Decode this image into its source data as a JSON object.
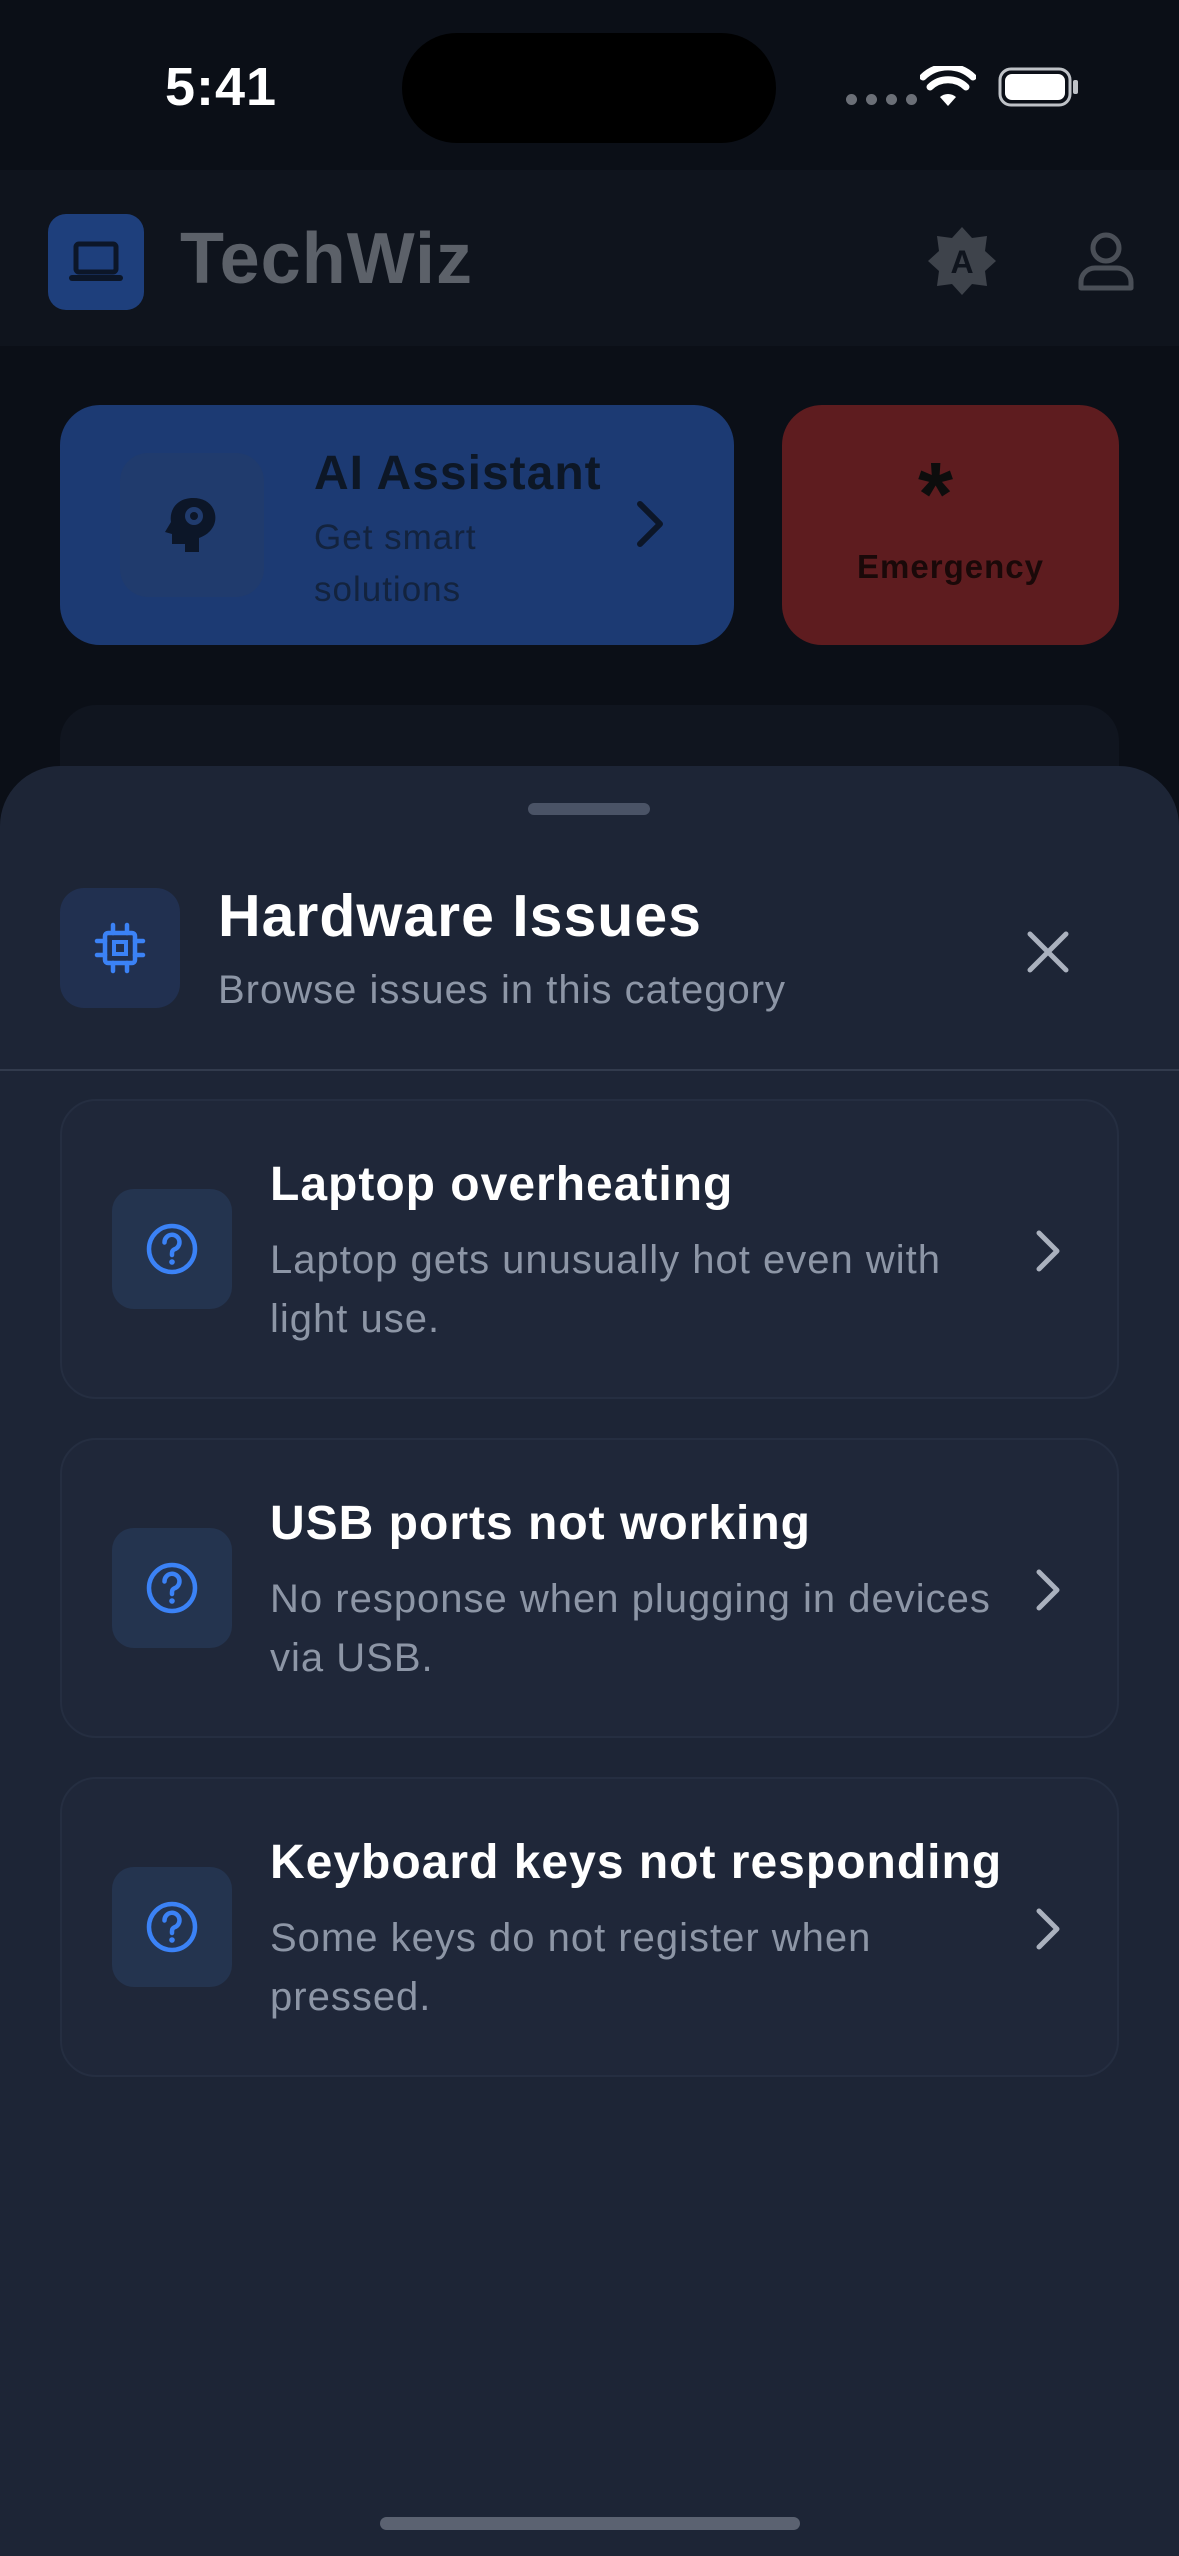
{
  "status_bar": {
    "time": "5:41"
  },
  "header": {
    "app_title": "TechWiz"
  },
  "ai_card": {
    "title": "AI Assistant",
    "subtitle": "Get smart solutions"
  },
  "emergency": {
    "label": "Emergency",
    "symbol": "*"
  },
  "sheet": {
    "title": "Hardware Issues",
    "subtitle": "Browse issues in this category",
    "issues": [
      {
        "title": "Laptop overheating",
        "description": "Laptop gets unusually hot even with light use."
      },
      {
        "title": "USB ports not working",
        "description": "No response when plugging in devices via USB."
      },
      {
        "title": "Keyboard keys not responding",
        "description": "Some keys do not register when pressed."
      }
    ]
  },
  "colors": {
    "accent": "#3b82f6",
    "sheet_bg": "#1d2536",
    "emergency": "#5e1c1f"
  },
  "icons": [
    "laptop-icon",
    "brightness-auto-icon",
    "user-icon",
    "brain-gear-icon",
    "chevron-right-icon",
    "cpu-chip-icon",
    "close-icon",
    "help-circle-icon"
  ]
}
